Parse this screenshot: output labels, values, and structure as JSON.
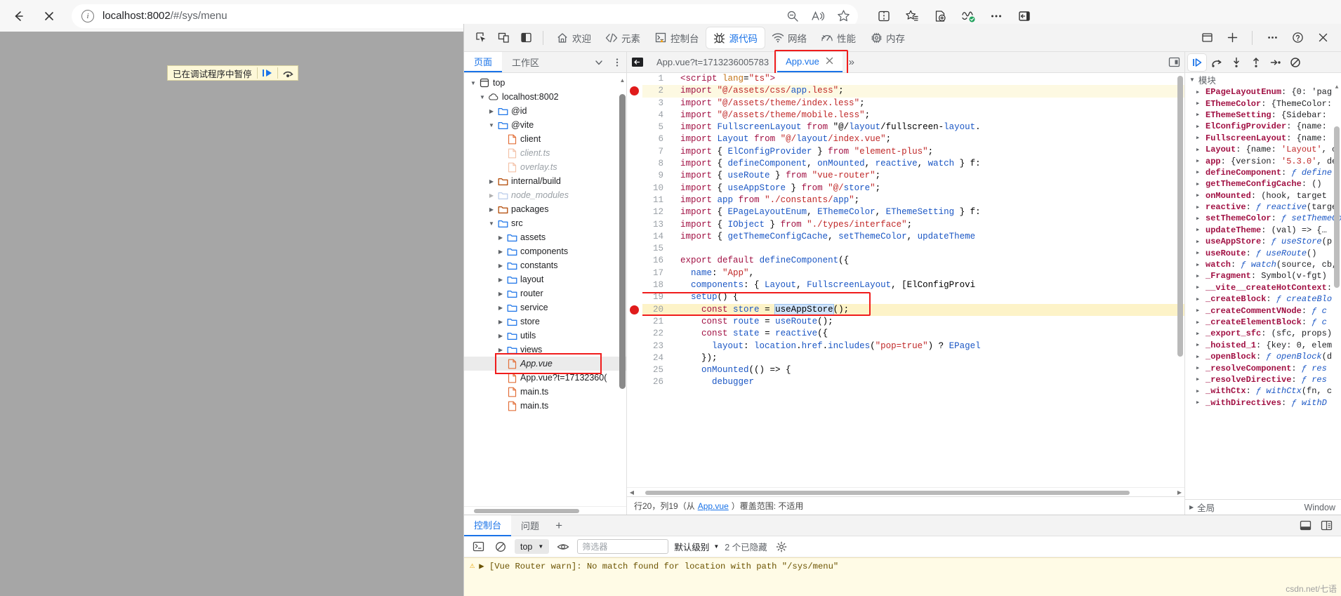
{
  "browser": {
    "back_label": "←",
    "stop_label": "✕",
    "url_host": "localhost:8002",
    "url_path": "/#/sys/menu",
    "omnibox_icons": [
      "zoom-out-icon",
      "read-aloud-icon",
      "favorite-icon"
    ],
    "toolbar_icons": [
      "split-screen-icon",
      "collections-icon",
      "add-to-collection-icon",
      "browser-essentials-icon",
      "more-icon",
      "sidebar-icon"
    ]
  },
  "page": {
    "paused_banner": "已在调试程序中暂停",
    "resume_label": "▶",
    "step_label": "↷"
  },
  "devtools": {
    "tabs": [
      {
        "label": "欢迎",
        "icon": "home-icon",
        "active": false
      },
      {
        "label": "元素",
        "icon": "code-brackets-icon",
        "active": false
      },
      {
        "label": "控制台",
        "icon": "console-icon",
        "active": false
      },
      {
        "label": "源代码",
        "icon": "sources-bug-icon",
        "active": true
      },
      {
        "label": "网络",
        "icon": "network-wifi-icon",
        "active": false
      },
      {
        "label": "性能",
        "icon": "performance-gauge-icon",
        "active": false
      },
      {
        "label": "内存",
        "icon": "memory-chip-icon",
        "active": false
      }
    ],
    "left_icons": [
      "inspect-element-icon",
      "device-toolbar-icon",
      "dock-side-icon"
    ],
    "right_icons": [
      "drawer-icon",
      "add-tab-icon",
      "more-tools-icon",
      "help-icon",
      "close-icon"
    ]
  },
  "navigator": {
    "tabs": [
      {
        "label": "页面",
        "active": true
      },
      {
        "label": "工作区",
        "active": false
      }
    ],
    "more_icon": "chevron-down-icon",
    "menu_icon": "kebab-menu-icon",
    "tree": [
      {
        "label": "top",
        "indent": 0,
        "arrow": "down",
        "icon": "frame-icon",
        "style": "normal"
      },
      {
        "label": "localhost:8002",
        "indent": 1,
        "arrow": "down",
        "icon": "cloud-icon",
        "style": "normal"
      },
      {
        "label": "@id",
        "indent": 2,
        "arrow": "right",
        "icon": "folder-blue-icon",
        "style": "normal"
      },
      {
        "label": "@vite",
        "indent": 2,
        "arrow": "down",
        "icon": "folder-blue-icon",
        "style": "normal"
      },
      {
        "label": "client",
        "indent": 3,
        "arrow": "none",
        "icon": "file-orange-icon",
        "style": "normal"
      },
      {
        "label": "client.ts",
        "indent": 3,
        "arrow": "none",
        "icon": "file-faded-icon",
        "style": "dim"
      },
      {
        "label": "overlay.ts",
        "indent": 3,
        "arrow": "none",
        "icon": "file-faded-icon",
        "style": "dim"
      },
      {
        "label": "internal/build",
        "indent": 2,
        "arrow": "right",
        "icon": "folder-orange-icon",
        "style": "normal"
      },
      {
        "label": "node_modules",
        "indent": 2,
        "arrow": "right",
        "icon": "folder-faded-icon",
        "style": "dim"
      },
      {
        "label": "packages",
        "indent": 2,
        "arrow": "right",
        "icon": "folder-orange-icon",
        "style": "normal"
      },
      {
        "label": "src",
        "indent": 2,
        "arrow": "down",
        "icon": "folder-blue-icon",
        "style": "normal"
      },
      {
        "label": "assets",
        "indent": 3,
        "arrow": "right",
        "icon": "folder-blue-icon",
        "style": "normal"
      },
      {
        "label": "components",
        "indent": 3,
        "arrow": "right",
        "icon": "folder-blue-icon",
        "style": "normal"
      },
      {
        "label": "constants",
        "indent": 3,
        "arrow": "right",
        "icon": "folder-blue-icon",
        "style": "normal"
      },
      {
        "label": "layout",
        "indent": 3,
        "arrow": "right",
        "icon": "folder-blue-icon",
        "style": "normal"
      },
      {
        "label": "router",
        "indent": 3,
        "arrow": "right",
        "icon": "folder-blue-icon",
        "style": "normal"
      },
      {
        "label": "service",
        "indent": 3,
        "arrow": "right",
        "icon": "folder-blue-icon",
        "style": "normal"
      },
      {
        "label": "store",
        "indent": 3,
        "arrow": "right",
        "icon": "folder-blue-icon",
        "style": "normal"
      },
      {
        "label": "utils",
        "indent": 3,
        "arrow": "right",
        "icon": "folder-blue-icon",
        "style": "normal"
      },
      {
        "label": "views",
        "indent": 3,
        "arrow": "right",
        "icon": "folder-blue-icon",
        "style": "normal"
      },
      {
        "label": "App.vue",
        "indent": 3,
        "arrow": "none",
        "icon": "file-orange-icon",
        "style": "selected-italic"
      },
      {
        "label": "App.vue?t=17132360(",
        "indent": 3,
        "arrow": "none",
        "icon": "file-orange-icon",
        "style": "normal"
      },
      {
        "label": "main.ts",
        "indent": 3,
        "arrow": "none",
        "icon": "file-orange-icon",
        "style": "normal"
      },
      {
        "label": "main.ts",
        "indent": 3,
        "arrow": "none",
        "icon": "file-orange-icon",
        "style": "normal"
      }
    ]
  },
  "editor": {
    "back_icon": "back-to-nav-icon",
    "tabs": [
      {
        "label": "App.vue?t=1713236005783",
        "active": false,
        "closable": false
      },
      {
        "label": "App.vue",
        "active": true,
        "closable": true,
        "highlighted": true
      }
    ],
    "overflow_label": "»",
    "popout_icon": "popout-icon",
    "status_line": "行20，列19（从",
    "status_link": "App.vue",
    "status_tail": "）覆盖范围: 不适用",
    "breakpoint_lines": [
      2,
      20
    ],
    "execution_line": 20,
    "lines": [
      {
        "n": 1,
        "text": "<script lang=\"ts\">"
      },
      {
        "n": 2,
        "text": "import \"@/assets/css/app.less\";"
      },
      {
        "n": 3,
        "text": "import \"@/assets/theme/index.less\";"
      },
      {
        "n": 4,
        "text": "import \"@/assets/theme/mobile.less\";"
      },
      {
        "n": 5,
        "text": "import FullscreenLayout from \"@/layout/fullscreen-layout."
      },
      {
        "n": 6,
        "text": "import Layout from \"@/layout/index.vue\";"
      },
      {
        "n": 7,
        "text": "import { ElConfigProvider } from \"element-plus\";"
      },
      {
        "n": 8,
        "text": "import { defineComponent, onMounted, reactive, watch } f:"
      },
      {
        "n": 9,
        "text": "import { useRoute } from \"vue-router\";"
      },
      {
        "n": 10,
        "text": "import { useAppStore } from \"@/store\";"
      },
      {
        "n": 11,
        "text": "import app from \"./constants/app\";"
      },
      {
        "n": 12,
        "text": "import { EPageLayoutEnum, EThemeColor, EThemeSetting } f:"
      },
      {
        "n": 13,
        "text": "import { IObject } from \"./types/interface\";"
      },
      {
        "n": 14,
        "text": "import { getThemeConfigCache, setThemeColor, updateTheme"
      },
      {
        "n": 15,
        "text": ""
      },
      {
        "n": 16,
        "text": "export default defineComponent({"
      },
      {
        "n": 17,
        "text": "  name: \"App\","
      },
      {
        "n": 18,
        "text": "  components: { Layout, FullscreenLayout, [ElConfigProvi"
      },
      {
        "n": 19,
        "text": "  setup() {"
      },
      {
        "n": 20,
        "text": "    const store = useAppStore();"
      },
      {
        "n": 21,
        "text": "    const route = useRoute();"
      },
      {
        "n": 22,
        "text": "    const state = reactive({"
      },
      {
        "n": 23,
        "text": "      layout: location.href.includes(\"pop=true\") ? EPagel"
      },
      {
        "n": 24,
        "text": "    });"
      },
      {
        "n": 25,
        "text": "    onMounted(() => {"
      },
      {
        "n": 26,
        "text": "      debugger"
      }
    ]
  },
  "debugger": {
    "toolbar_icons": [
      "resume-icon",
      "step-over-icon",
      "step-into-icon",
      "step-out-icon",
      "step-icon",
      "deactivate-breakpoints-icon"
    ],
    "scope_title": "模块",
    "footer_left": "全局",
    "footer_right": "Window",
    "scope_rows": [
      {
        "name": "EPageLayoutEnum",
        "value": "{0: 'pag"
      },
      {
        "name": "EThemeColor",
        "value": "{ThemeColor:"
      },
      {
        "name": "EThemeSetting",
        "value": "{Sidebar:"
      },
      {
        "name": "ElConfigProvider",
        "value": "{name:"
      },
      {
        "name": "FullscreenLayout",
        "value": "{name:"
      },
      {
        "name": "Layout",
        "value": "{name: 'Layout', c"
      },
      {
        "name": "app",
        "value": "{version: '5.3.0', de"
      },
      {
        "name": "defineComponent",
        "value": "ƒ define"
      },
      {
        "name": "getThemeConfigCache",
        "value": "()"
      },
      {
        "name": "onMounted",
        "value": "(hook, target"
      },
      {
        "name": "reactive",
        "value": "ƒ reactive(targe"
      },
      {
        "name": "setThemeColor",
        "value": "ƒ setThemeColor"
      },
      {
        "name": "updateTheme",
        "value": "(val) => {…"
      },
      {
        "name": "useAppStore",
        "value": "ƒ useStore(p"
      },
      {
        "name": "useRoute",
        "value": "ƒ useRoute()"
      },
      {
        "name": "watch",
        "value": "ƒ watch(source, cb,"
      },
      {
        "name": "_Fragment",
        "value": "Symbol(v-fgt)"
      },
      {
        "name": "__vite__createHotContext",
        "value": ""
      },
      {
        "name": "_createBlock",
        "value": "ƒ createBlo"
      },
      {
        "name": "_createCommentVNode",
        "value": "ƒ c"
      },
      {
        "name": "_createElementBlock",
        "value": "ƒ c"
      },
      {
        "name": "_export_sfc",
        "value": "(sfc, props)"
      },
      {
        "name": "_hoisted_1",
        "value": "{key: 0, elem"
      },
      {
        "name": "_openBlock",
        "value": "ƒ openBlock(d"
      },
      {
        "name": "_resolveComponent",
        "value": "ƒ res"
      },
      {
        "name": "_resolveDirective",
        "value": "ƒ res"
      },
      {
        "name": "_withCtx",
        "value": "ƒ withCtx(fn, c"
      },
      {
        "name": "_withDirectives",
        "value": "ƒ withD"
      }
    ]
  },
  "drawer": {
    "tabs": [
      {
        "label": "控制台",
        "active": true
      },
      {
        "label": "问题",
        "active": false
      }
    ],
    "add_label": "+",
    "right_icons": [
      "drawer-expand-icon",
      "drawer-settings-icon"
    ],
    "console": {
      "clear_icon": "clear-console-icon",
      "no_entry_icon": "no-entry-icon",
      "eye_icon": "eye-icon",
      "context": "top",
      "filter_placeholder": "筛选器",
      "level": "默认级别",
      "hidden_count": "2 个已隐藏",
      "settings_icon": "gear-icon",
      "messages": [
        {
          "level": "warning",
          "text": "▶ [Vue Router warn]: No match found for location with path \"/sys/menu\""
        }
      ]
    }
  },
  "watermark": "csdn.net/七语"
}
